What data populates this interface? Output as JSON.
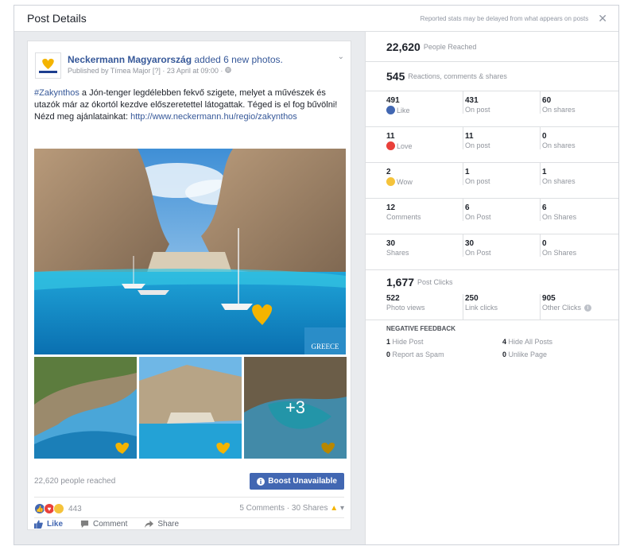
{
  "header": {
    "title": "Post Details",
    "note": "Reported stats may be delayed from what appears on posts",
    "close_glyph": "✕"
  },
  "post": {
    "page_name": "Neckermann Magyarország",
    "action_text": "added 6 new photos.",
    "published": "Published by Tímea Major [?] · 23 April at 09:00 · ",
    "hashtag": "#Zakynthos",
    "text_rest": " a Jón-tenger legdélebben fekvő szigete, melyet a művészek és utazók már az ókortól kezdve előszeretettel látogattak. Téged is el fog bűvölni!",
    "text_line2": "Nézd meg ajánlatainkat: ",
    "link": "http://www.neckermann.hu/regio/zakynthos",
    "more_photos": "+3",
    "watermark": "GREECE",
    "reach_text": "22,620 people reached",
    "boost_label": "Boost Unavailable",
    "reactions_count": "443",
    "comments_shares": "5 Comments · 30 Shares",
    "like_label": "Like",
    "comment_label": "Comment",
    "share_label": "Share"
  },
  "stats": {
    "reached_value": "22,620",
    "reached_label": "People Reached",
    "engagement_value": "545",
    "engagement_label": "Reactions, comments & shares",
    "rows": [
      {
        "total": "491",
        "label": "Like",
        "on_post": "431",
        "on_post_label": "On post",
        "on_shares": "60",
        "on_shares_label": "On shares"
      },
      {
        "total": "11",
        "label": "Love",
        "on_post": "11",
        "on_post_label": "On post",
        "on_shares": "0",
        "on_shares_label": "On shares"
      },
      {
        "total": "2",
        "label": "Wow",
        "on_post": "1",
        "on_post_label": "On post",
        "on_shares": "1",
        "on_shares_label": "On shares"
      },
      {
        "total": "12",
        "label": "Comments",
        "on_post": "6",
        "on_post_label": "On Post",
        "on_shares": "6",
        "on_shares_label": "On Shares"
      },
      {
        "total": "30",
        "label": "Shares",
        "on_post": "30",
        "on_post_label": "On Post",
        "on_shares": "0",
        "on_shares_label": "On Shares"
      }
    ],
    "clicks_value": "1,677",
    "clicks_label": "Post Clicks",
    "photo_views": "522",
    "photo_views_label": "Photo views",
    "link_clicks": "250",
    "link_clicks_label": "Link clicks",
    "other_clicks": "905",
    "other_clicks_label": "Other Clicks",
    "negative_title": "NEGATIVE FEEDBACK",
    "hide_post": "1",
    "hide_post_label": "Hide Post",
    "hide_all": "4",
    "hide_all_label": "Hide All Posts",
    "spam": "0",
    "spam_label": "Report as Spam",
    "unlike": "0",
    "unlike_label": "Unlike Page"
  },
  "colors": {
    "brand_blue": "#4267b2",
    "link_blue": "#365899",
    "love_red": "#e9403a",
    "wow_yellow": "#f5c33b"
  }
}
